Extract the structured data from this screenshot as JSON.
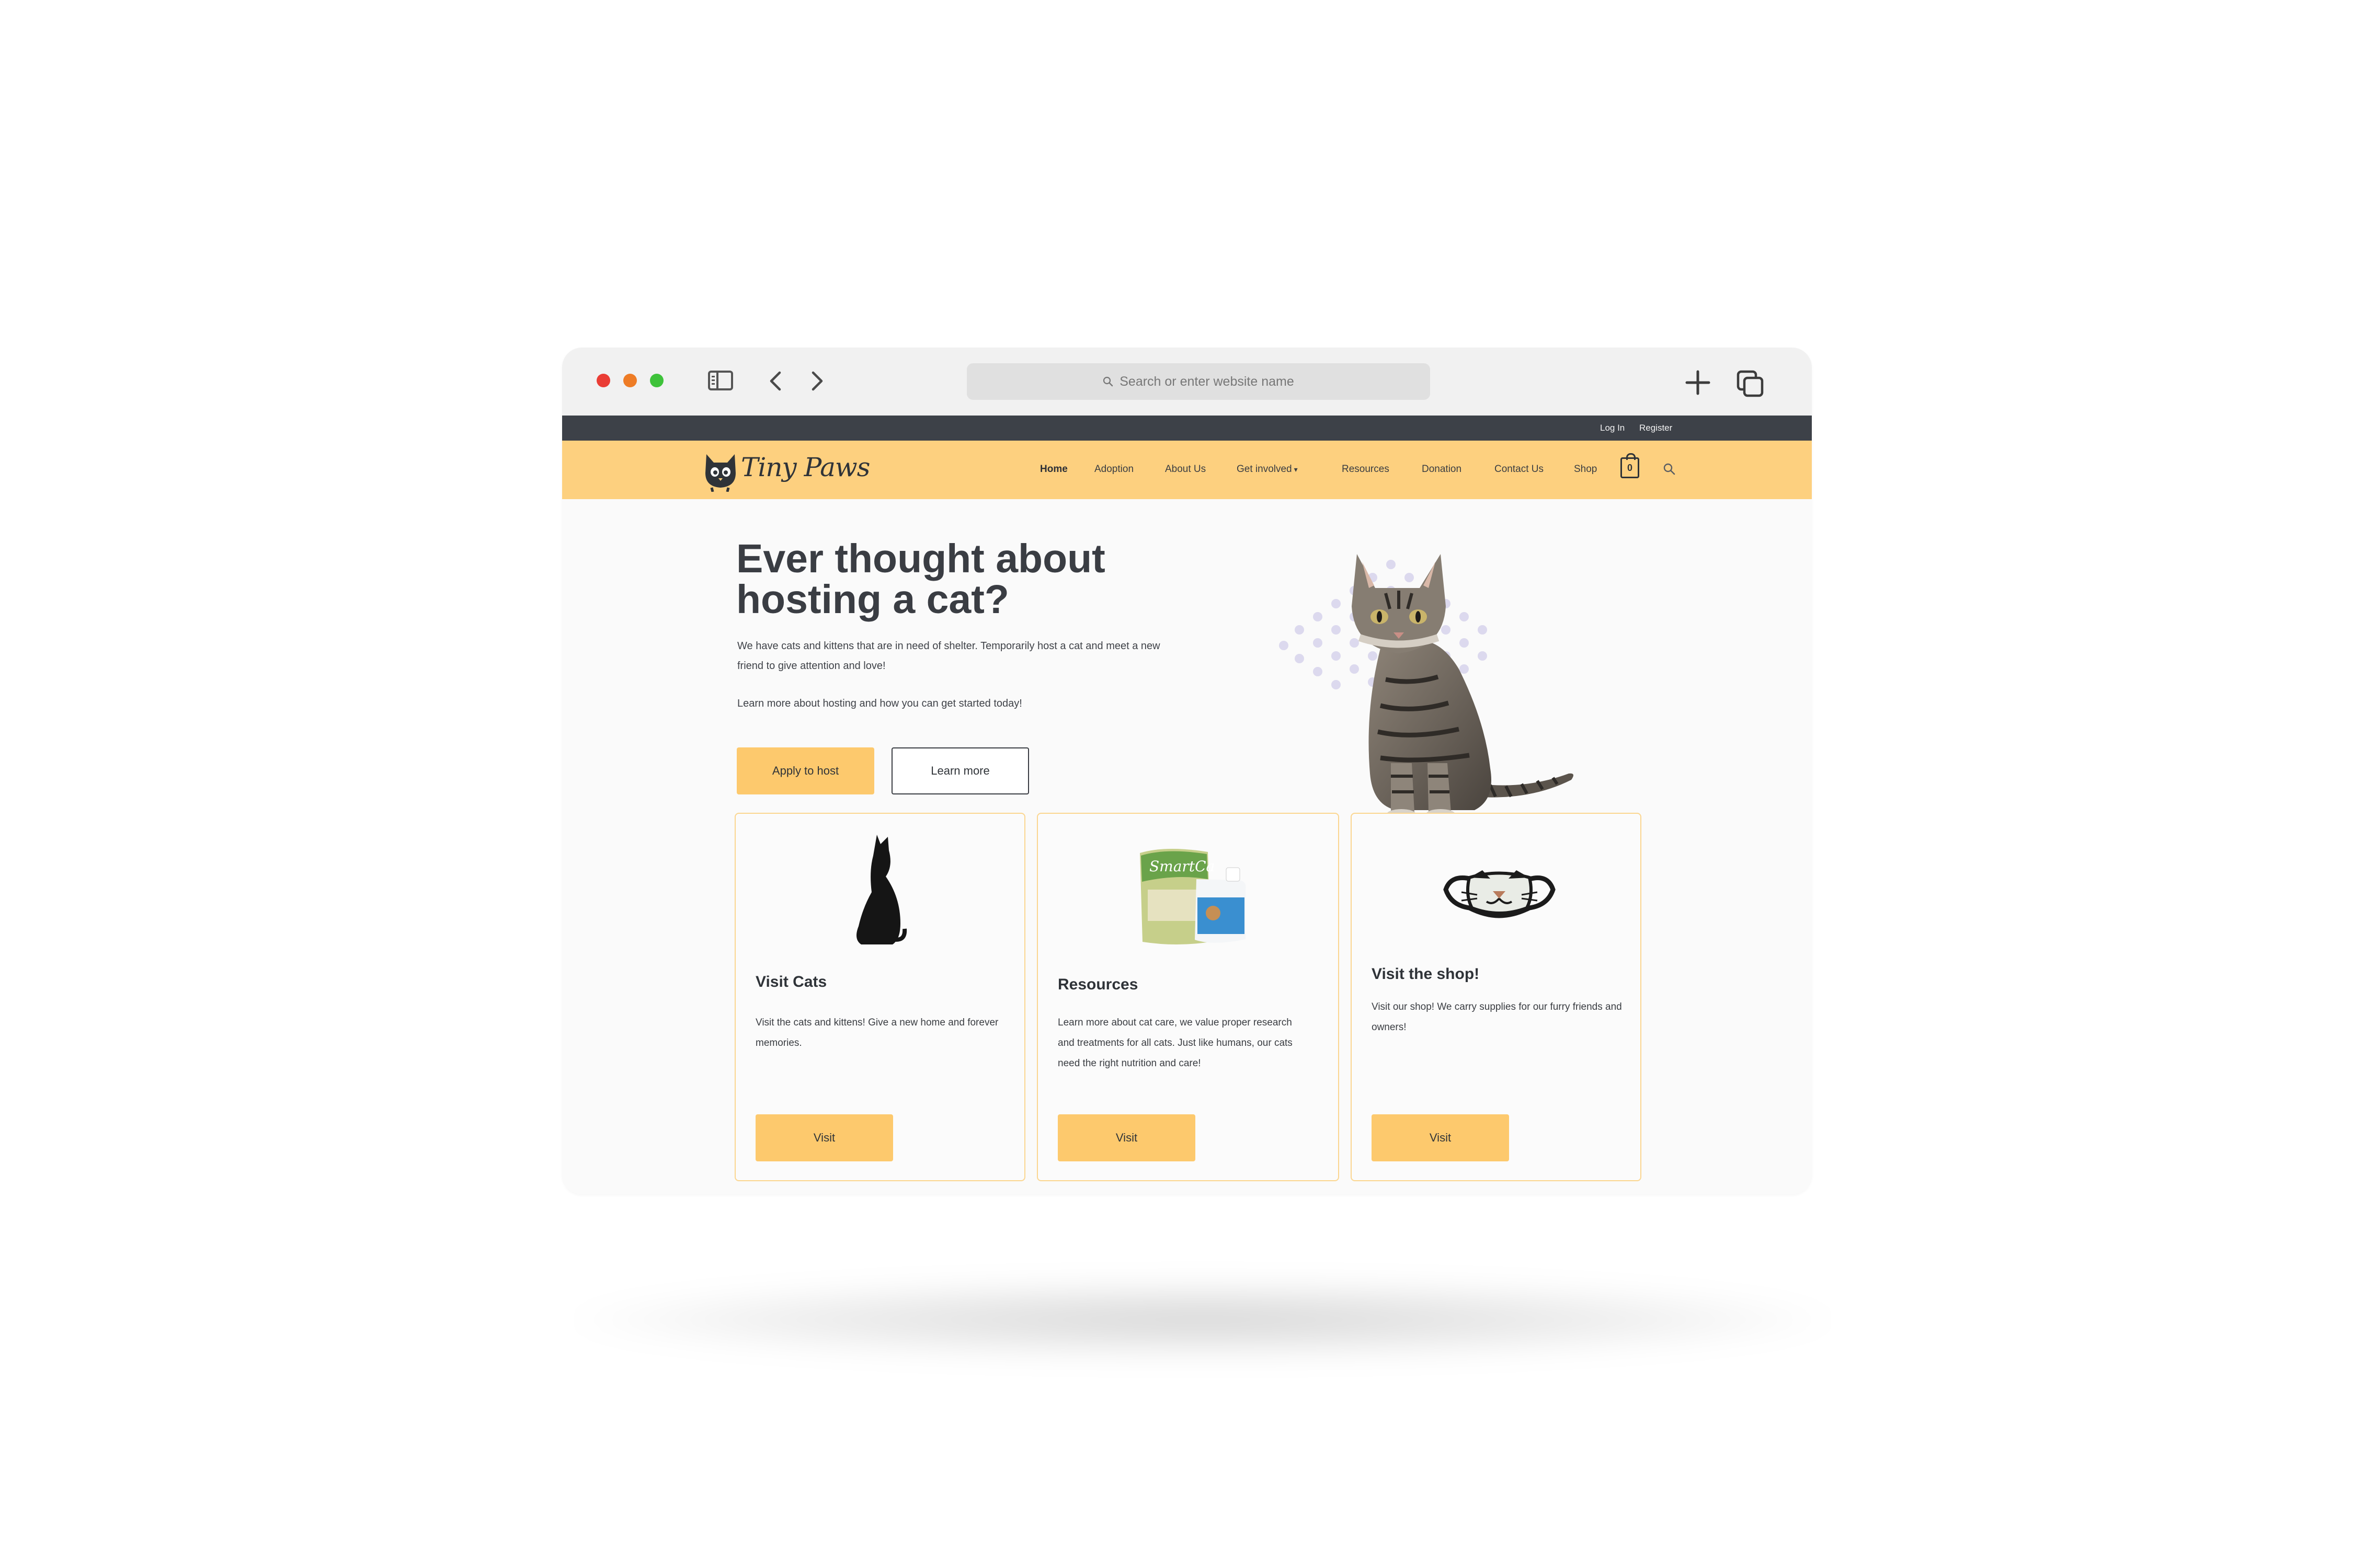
{
  "browser": {
    "address_placeholder": "Search or enter website name"
  },
  "topbar": {
    "login": "Log In",
    "register": "Register"
  },
  "brand": {
    "name": "Tiny Paws",
    "primary_color": "#fdd07f",
    "button_color": "#fdc96d",
    "dark_color": "#3d4148"
  },
  "nav": {
    "items": [
      {
        "label": "Home"
      },
      {
        "label": "Adoption"
      },
      {
        "label": "About Us"
      },
      {
        "label": "Get involved"
      },
      {
        "label": "Resources"
      },
      {
        "label": "Donation"
      },
      {
        "label": "Contact Us"
      },
      {
        "label": "Shop"
      }
    ],
    "cart_count": "0"
  },
  "hero": {
    "title": "Ever thought about hosting a cat?",
    "paragraph1": "We have cats and kittens that are in need of shelter. Temporarily host a cat and meet a new friend to give attention and love!",
    "paragraph2": "Learn more about hosting and how you can get started today!",
    "apply_label": "Apply to host",
    "learn_label": "Learn more"
  },
  "cards": [
    {
      "title": "Visit Cats",
      "text": "Visit the cats and kittens! Give a new home and forever memories.",
      "button": "Visit",
      "image": "black-cat-image"
    },
    {
      "title": "Resources",
      "text": "Learn more about cat care, we value proper research and treatments for all cats. Just like humans, our cats need the right nutrition and care!",
      "button": "Visit",
      "image": "cat-litter-products-image"
    },
    {
      "title": "Visit the shop!",
      "text": "Visit our shop! We carry supplies for our furry friends and owners!",
      "button": "Visit",
      "image": "cat-face-mask-image"
    }
  ]
}
